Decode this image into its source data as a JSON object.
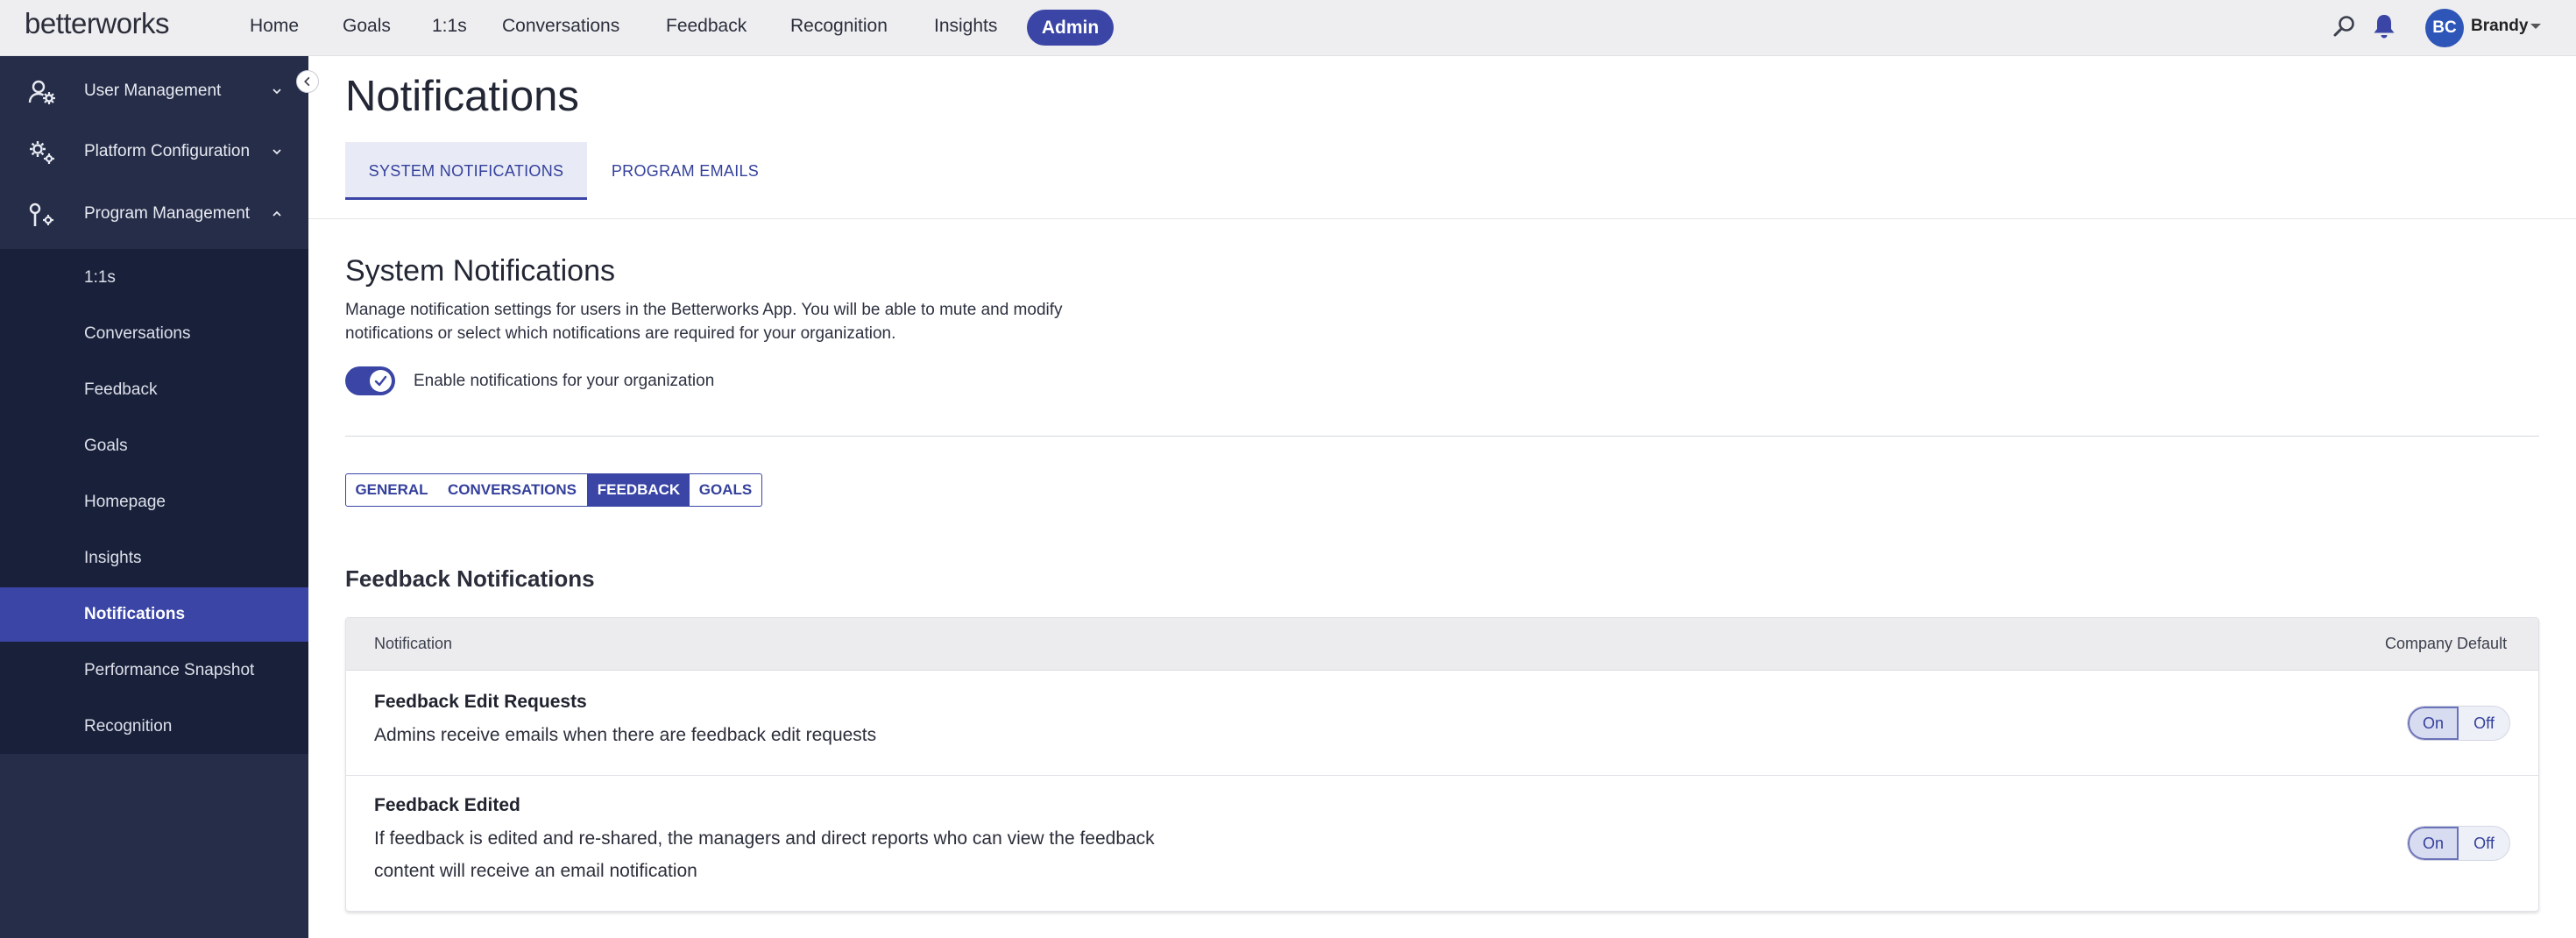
{
  "app": {
    "logo_text": "betterworks",
    "nav": [
      "Home",
      "Goals",
      "1:1s",
      "Conversations",
      "Feedback",
      "Recognition",
      "Insights"
    ],
    "nav_active": "Admin",
    "user": {
      "initials": "BC",
      "name": "Brandy"
    }
  },
  "sidebar": {
    "groups": [
      {
        "label": "User Management",
        "icon": "user-gear-icon",
        "expanded": false
      },
      {
        "label": "Platform Configuration",
        "icon": "gears-icon",
        "expanded": false
      },
      {
        "label": "Program Management",
        "icon": "tools-icon",
        "expanded": true
      }
    ],
    "items": [
      "1:1s",
      "Conversations",
      "Feedback",
      "Goals",
      "Homepage",
      "Insights",
      "Notifications",
      "Performance Snapshot",
      "Recognition"
    ],
    "active_item": "Notifications"
  },
  "page": {
    "title": "Notifications",
    "tabs": [
      "SYSTEM NOTIFICATIONS",
      "PROGRAM EMAILS"
    ],
    "active_tab": "SYSTEM NOTIFICATIONS"
  },
  "system": {
    "title": "System Notifications",
    "description": "Manage notification settings for users in the Betterworks App. You will be able to mute and modify notifications or select which notifications are required for your organization.",
    "toggle_label": "Enable notifications for your organization",
    "toggle_on": true
  },
  "categories": {
    "items": [
      "GENERAL",
      "CONVERSATIONS",
      "FEEDBACK",
      "GOALS"
    ],
    "active": "FEEDBACK"
  },
  "feedback": {
    "title": "Feedback Notifications",
    "columns": {
      "notification": "Notification",
      "default": "Company Default"
    },
    "rows": [
      {
        "title": "Feedback Edit Requests",
        "description": "Admins receive emails when there are feedback edit requests",
        "on_label": "On",
        "off_label": "Off",
        "value": "On"
      },
      {
        "title": "Feedback Edited",
        "description": "If feedback is edited and re-shared, the managers and direct reports who can view the feedback content will receive an email notification",
        "on_label": "On",
        "off_label": "Off",
        "value": "On"
      }
    ]
  },
  "colors": {
    "brand": "#3a45a6",
    "sidebar": "#252d48",
    "sidebar_sub": "#19203a"
  }
}
